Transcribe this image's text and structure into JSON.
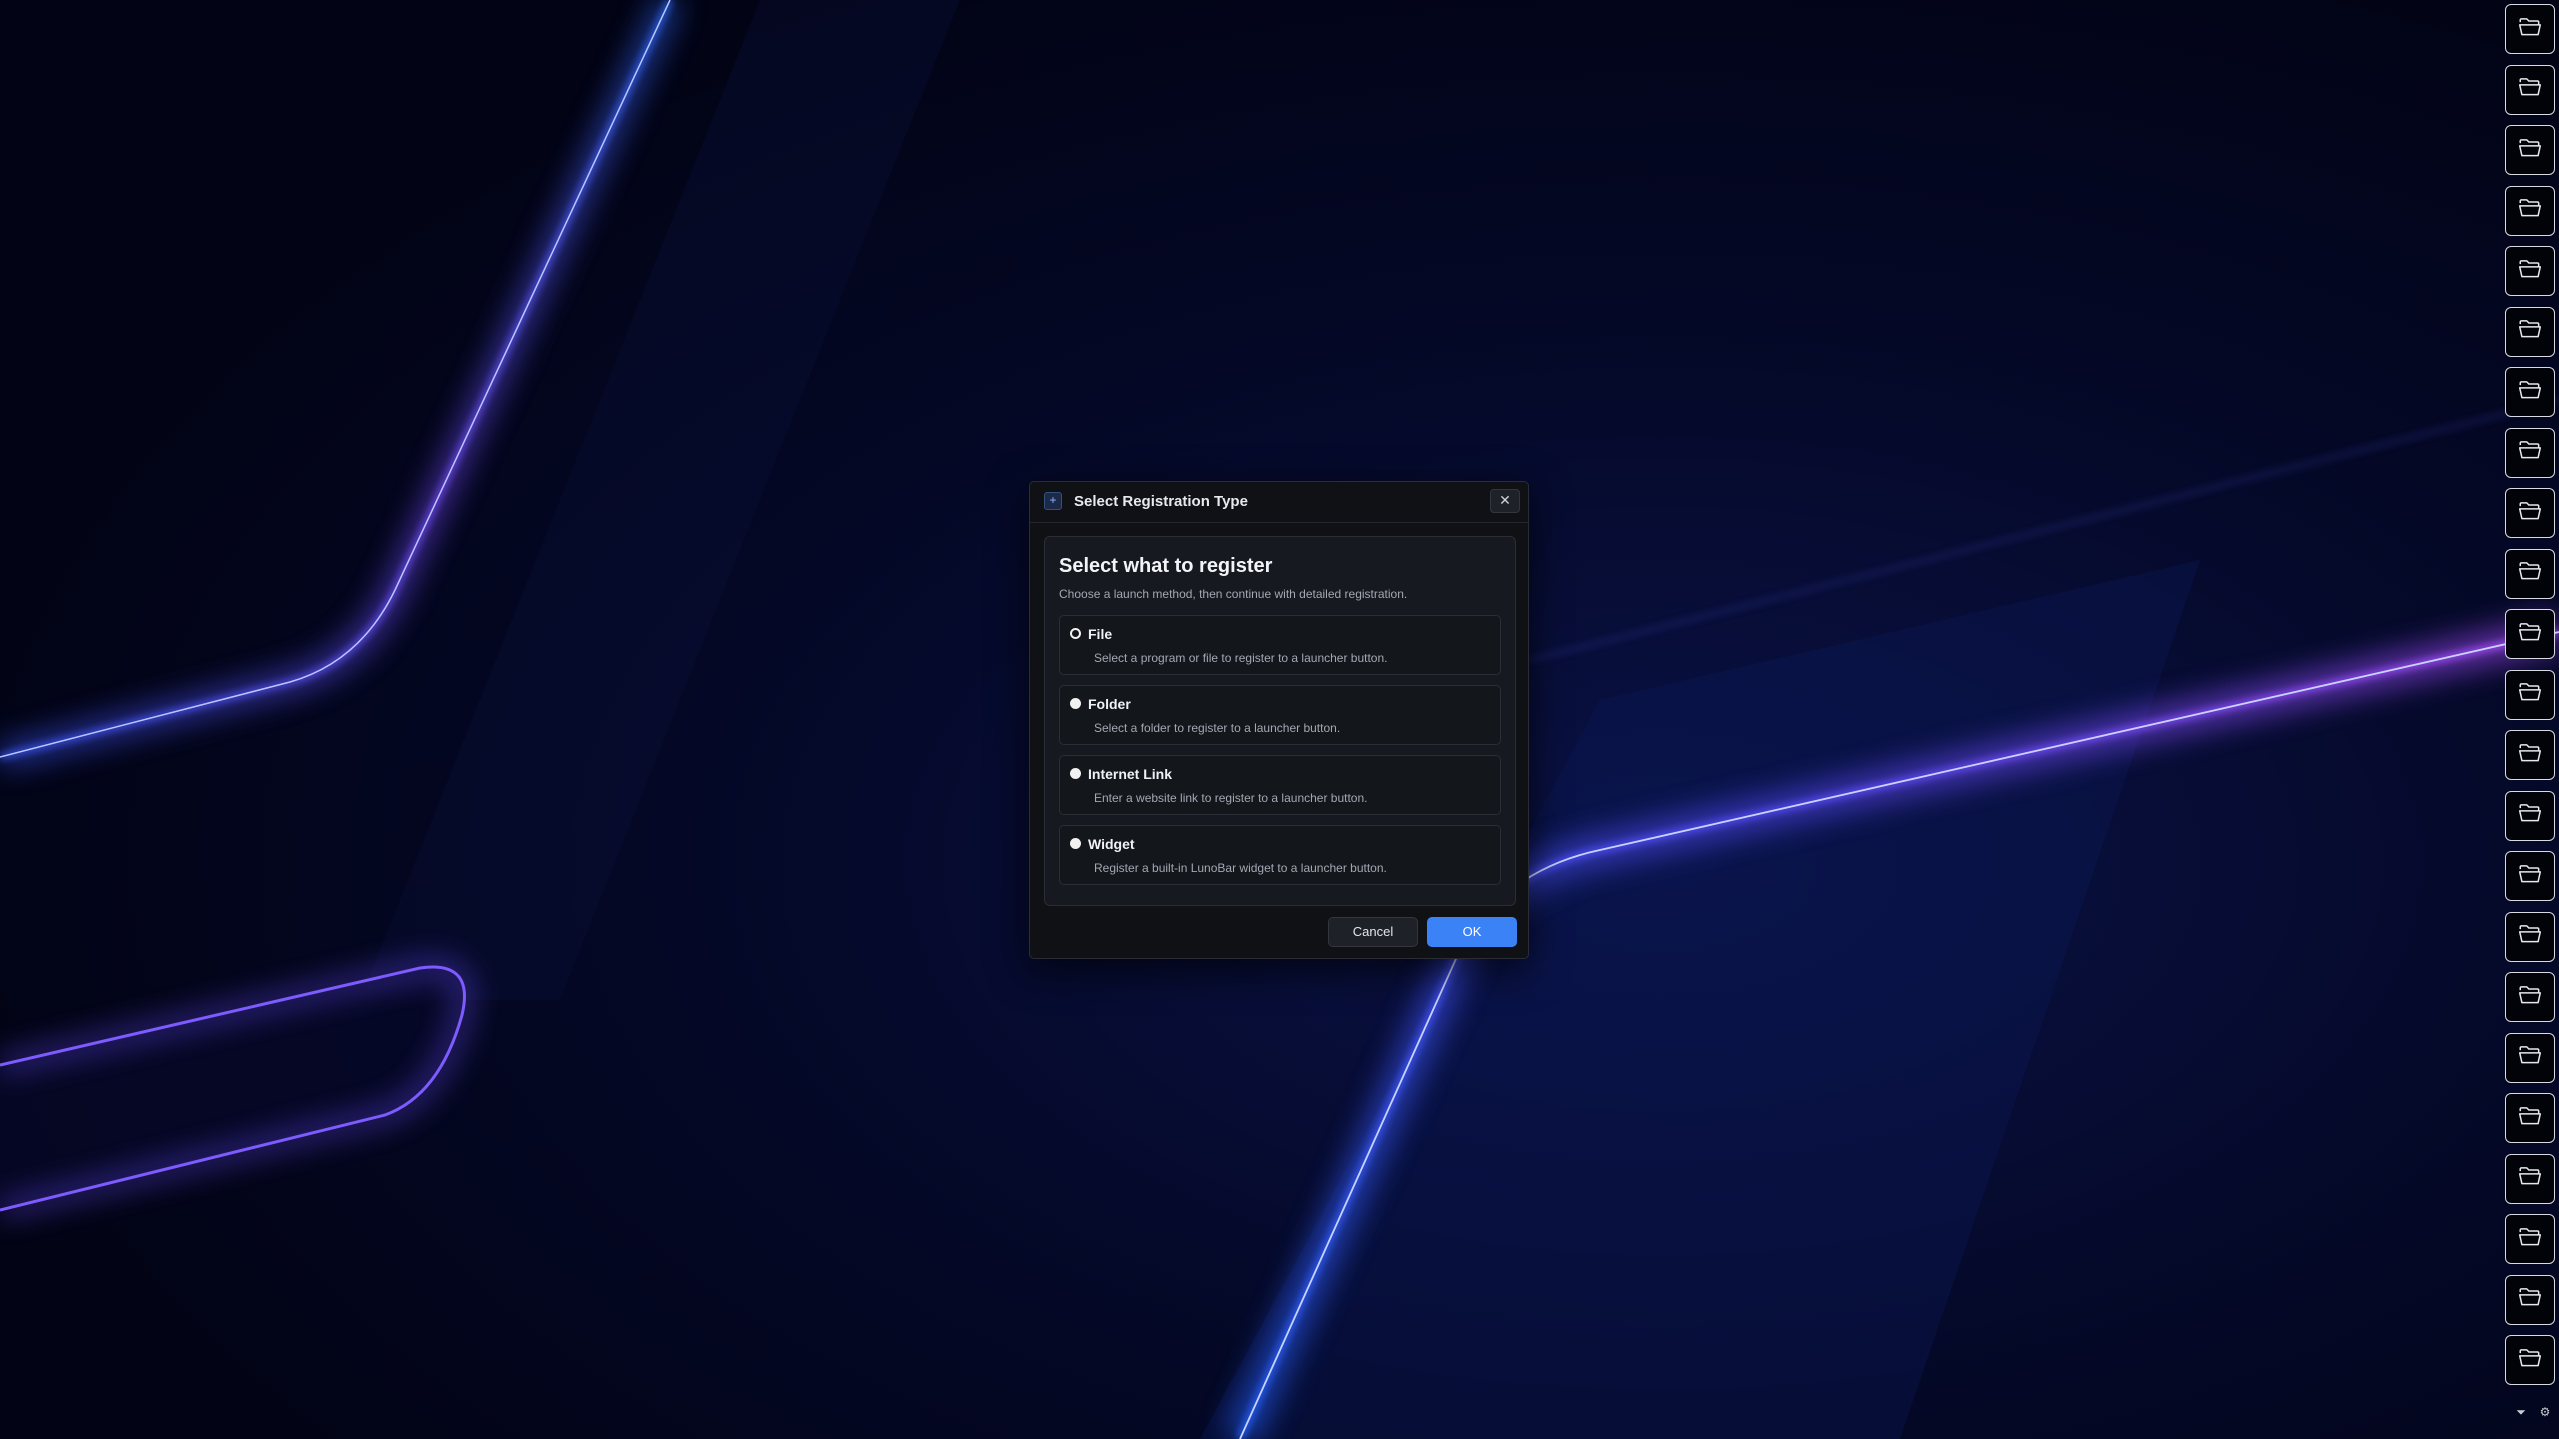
{
  "dialog": {
    "app_icon_glyph": "+",
    "title": "Select Registration Type",
    "close_glyph": "✕",
    "heading": "Select what to register",
    "subheading": "Choose a launch method, then continue with detailed registration.",
    "options": [
      {
        "label": "File",
        "description": "Select a program or file to register to a launcher button.",
        "selected": true
      },
      {
        "label": "Folder",
        "description": "Select a folder to register to a launcher button.",
        "selected": false
      },
      {
        "label": "Internet Link",
        "description": "Enter a website link to register to a launcher button.",
        "selected": false
      },
      {
        "label": "Widget",
        "description": "Register a built-in LunoBar widget to a launcher button.",
        "selected": false
      }
    ],
    "cancel_label": "Cancel",
    "ok_label": "OK"
  },
  "launcher": {
    "button_icon": "open-folder-icon",
    "button_count": 23,
    "collapse_glyph": "⏷",
    "settings_glyph": "⚙"
  },
  "colors": {
    "accent": "#3b82f6",
    "background": "#03041a",
    "glow_blue": "#2f6bff",
    "glow_violet": "#8a3dff"
  }
}
